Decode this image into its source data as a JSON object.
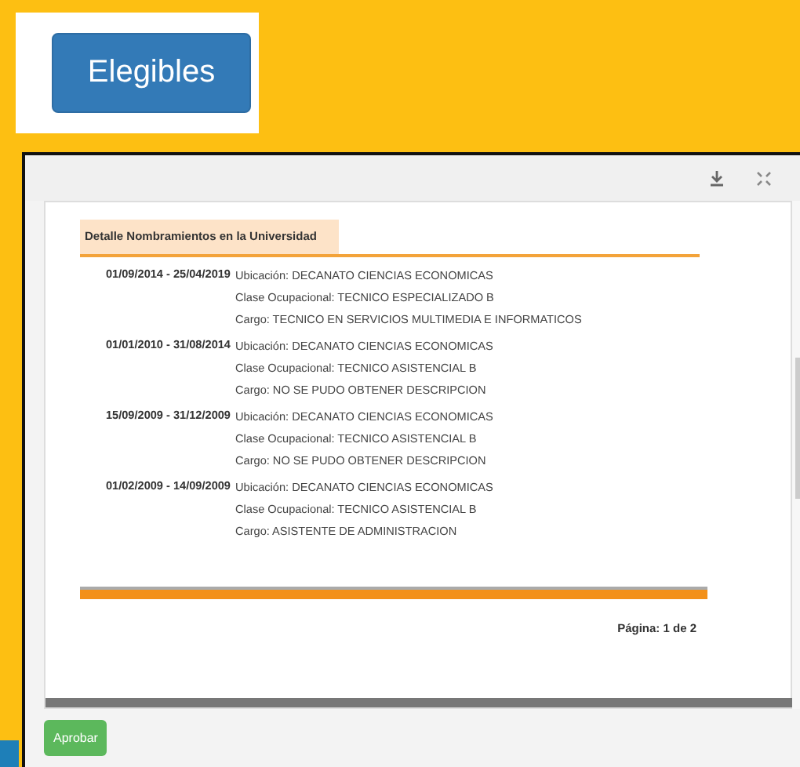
{
  "top_button": {
    "label": "Elegibles"
  },
  "report": {
    "section_title": "Detalle Nombramientos en la Universidad",
    "entries": [
      {
        "period": "01/09/2014 - 25/04/2019",
        "lines": [
          "Ubicación: DECANATO CIENCIAS ECONOMICAS",
          "Clase Ocupacional: TECNICO ESPECIALIZADO B",
          "Cargo: TECNICO EN SERVICIOS MULTIMEDIA E INFORMATICOS"
        ]
      },
      {
        "period": "01/01/2010 - 31/08/2014",
        "lines": [
          "Ubicación: DECANATO CIENCIAS ECONOMICAS",
          "Clase Ocupacional: TECNICO ASISTENCIAL B",
          "Cargo: NO SE PUDO OBTENER DESCRIPCION"
        ]
      },
      {
        "period": "15/09/2009 - 31/12/2009",
        "lines": [
          "Ubicación: DECANATO CIENCIAS ECONOMICAS",
          "Clase Ocupacional: TECNICO ASISTENCIAL B",
          "Cargo: NO SE PUDO OBTENER DESCRIPCION"
        ]
      },
      {
        "period": "01/02/2009 - 14/09/2009",
        "lines": [
          "Ubicación: DECANATO CIENCIAS ECONOMICAS",
          "Clase Ocupacional: TECNICO ASISTENCIAL B",
          "Cargo: ASISTENTE DE ADMINISTRACION"
        ]
      }
    ],
    "page_label": "Página: 1 de 2"
  },
  "approve_button": {
    "label": "Aprobar"
  }
}
